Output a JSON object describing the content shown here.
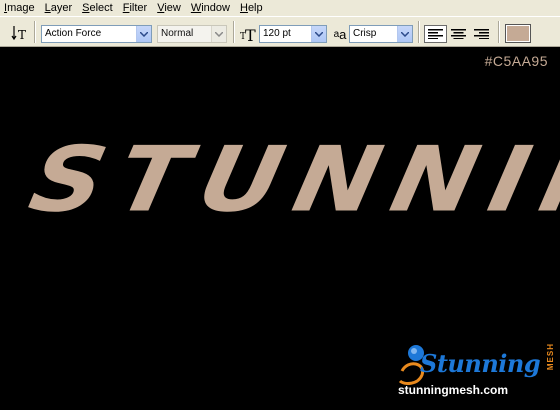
{
  "menu": [
    {
      "label": "Image",
      "accel": "I",
      "rest": "mage"
    },
    {
      "label": "Layer",
      "accel": "L",
      "rest": "ayer"
    },
    {
      "label": "Select",
      "accel": "S",
      "rest": "elect"
    },
    {
      "label": "Filter",
      "accel": "F",
      "rest": "ilter"
    },
    {
      "label": "View",
      "accel": "V",
      "rest": "iew"
    },
    {
      "label": "Window",
      "accel": "W",
      "rest": "indow"
    },
    {
      "label": "Help",
      "accel": "H",
      "rest": "elp"
    }
  ],
  "options": {
    "font_family": "Action Force",
    "font_style": "Normal",
    "font_size": "120 pt",
    "antialias_glyph": "a",
    "antialias_glyph_small": "a",
    "antialias": "Crisp",
    "text_color": "#c5aa95"
  },
  "canvas": {
    "text": "STUNNING",
    "text_color": "#c5aa95",
    "hex_label": "#C5AA95",
    "background": "#000000"
  },
  "watermark": {
    "wordmark": "Stunning",
    "mesh": "MESH",
    "url": "stunningmesh.com"
  }
}
